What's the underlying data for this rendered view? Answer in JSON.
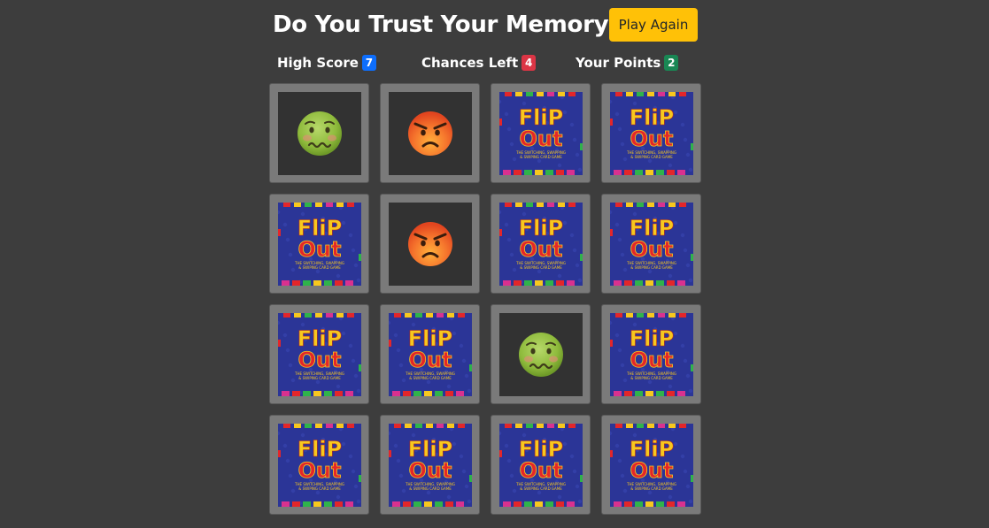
{
  "header": {
    "title": "Do You Trust Your Memory ?",
    "play_again_label": "Play Again"
  },
  "stats": [
    {
      "label": "High Score",
      "value": "7",
      "color": "#0d6efd"
    },
    {
      "label": "Chances Left",
      "value": "4",
      "color": "#dc3545"
    },
    {
      "label": "Your Points",
      "value": "2",
      "color": "#198754"
    }
  ],
  "card_back": {
    "logo_top": "FliP",
    "logo_bottom": "Out",
    "tagline_1": "THE SWITCHING, SWAPPING",
    "tagline_2": "& SWIPING CARD GAME"
  },
  "cards": [
    {
      "state": "revealed",
      "icon": "nauseated-face-icon"
    },
    {
      "state": "revealed",
      "icon": "angry-face-icon"
    },
    {
      "state": "hidden"
    },
    {
      "state": "hidden"
    },
    {
      "state": "hidden"
    },
    {
      "state": "revealed",
      "icon": "angry-face-icon"
    },
    {
      "state": "hidden"
    },
    {
      "state": "hidden"
    },
    {
      "state": "hidden"
    },
    {
      "state": "hidden"
    },
    {
      "state": "revealed",
      "icon": "nauseated-face-icon"
    },
    {
      "state": "hidden"
    },
    {
      "state": "hidden"
    },
    {
      "state": "hidden"
    },
    {
      "state": "hidden"
    },
    {
      "state": "hidden"
    }
  ],
  "colors": {
    "background": "#3d3d3d",
    "card_frame": "#7a7a7a",
    "card_face_up": "#323232",
    "card_back": "#2b3597",
    "logo_yellow": "#f7c81e",
    "logo_red": "#e3262a",
    "play_button": "#ffc107"
  }
}
